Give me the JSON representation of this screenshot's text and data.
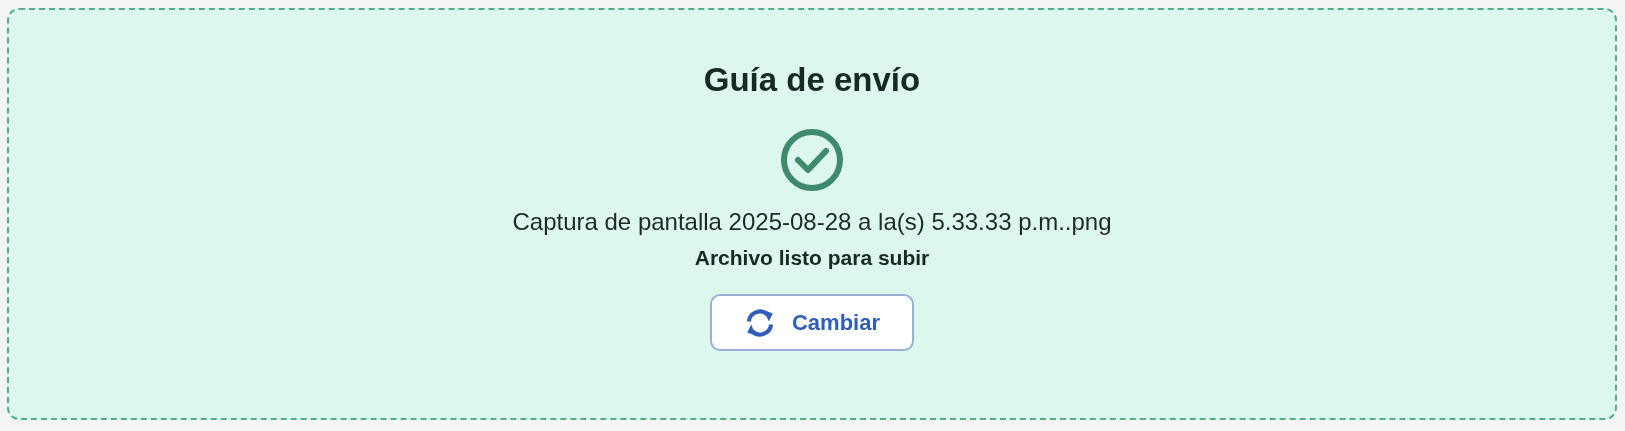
{
  "upload": {
    "title": "Guía de envío",
    "ready": true,
    "file_name": "Captura de pantalla 2025-08-28 a la(s) 5.33.33 p.m..png",
    "status_text": "Archivo listo para subir",
    "button": {
      "label": "Cambiar"
    }
  }
}
